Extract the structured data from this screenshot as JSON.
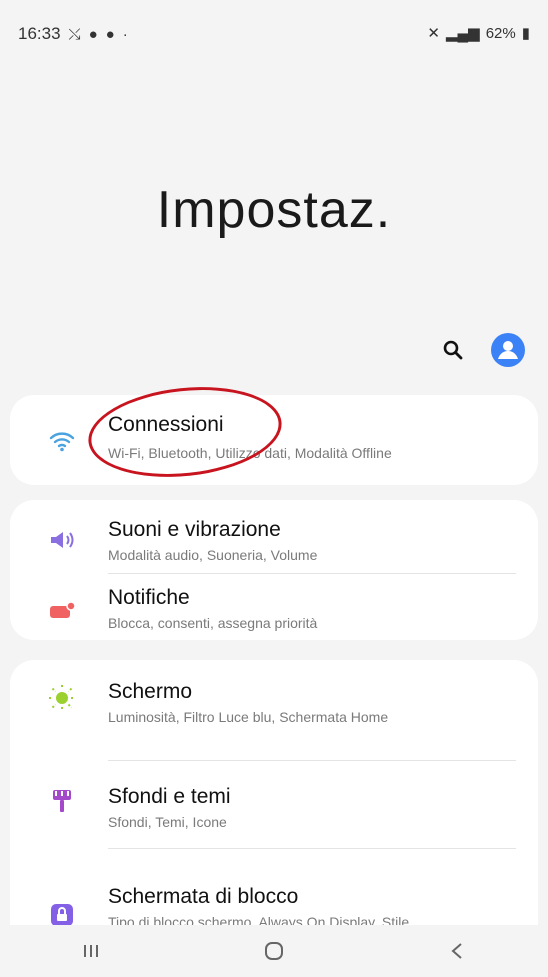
{
  "status": {
    "time": "16:33",
    "right_text": "62%"
  },
  "header": {
    "title": "Impostaz."
  },
  "items": [
    {
      "title": "Connessioni",
      "subtitle": "Wi-Fi, Bluetooth, Utilizzo dati, Modalità Offline",
      "icon": "wifi-icon",
      "color": "#4aa3df"
    },
    {
      "title": "Suoni e vibrazione",
      "subtitle": "Modalità audio, Suoneria, Volume",
      "icon": "speaker-icon",
      "color": "#8a6fe0"
    },
    {
      "title": "Notifiche",
      "subtitle": "Blocca, consenti, assegna priorità",
      "icon": "notification-icon",
      "color": "#f06262"
    },
    {
      "title": "Schermo",
      "subtitle": "Luminosità, Filtro Luce blu, Schermata Home",
      "icon": "sun-icon",
      "color": "#9bd12e"
    },
    {
      "title": "Sfondi e temi",
      "subtitle": "Sfondi, Temi, Icone",
      "icon": "brush-icon",
      "color": "#a349c9"
    },
    {
      "title": "Schermata di blocco",
      "subtitle": "Tipo di blocco schermo, Always On Display, Stile",
      "icon": "lock-icon",
      "color": "#8460e6"
    }
  ],
  "colors": {
    "accent": "#3b82f6",
    "annotation": "#c8141e"
  }
}
